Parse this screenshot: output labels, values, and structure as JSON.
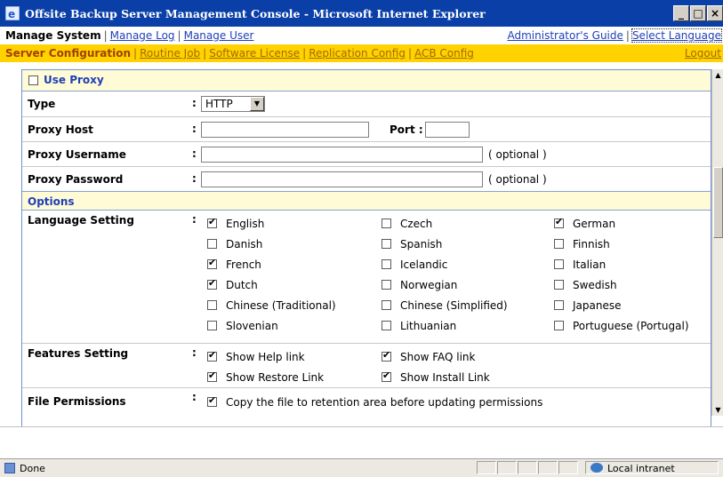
{
  "window": {
    "title": "Offsite Backup Server Management Console - Microsoft Internet Explorer",
    "icon": "ie-icon",
    "buttons": [
      "_",
      "□",
      "×"
    ]
  },
  "nav1": {
    "current": "Manage System",
    "links": [
      "Manage Log",
      "Manage User"
    ],
    "right_links": [
      "Administrator's Guide",
      "Select Language"
    ]
  },
  "nav2": {
    "current": "Server Configuration",
    "links": [
      "Routine Job",
      "Software License",
      "Replication Config",
      "ACB Config"
    ],
    "right_link": "Logout"
  },
  "proxy": {
    "use_proxy_label": "Use Proxy",
    "use_proxy_checked": false,
    "type_label": "Type",
    "type_value": "HTTP",
    "host_label": "Proxy Host",
    "host_value": "",
    "port_label": "Port :",
    "port_value": "",
    "username_label": "Proxy Username",
    "username_value": "",
    "password_label": "Proxy Password",
    "password_value": "",
    "optional_note": "( optional )"
  },
  "options": {
    "header": "Options",
    "language_label": "Language Setting",
    "languages": [
      {
        "label": "English",
        "checked": true
      },
      {
        "label": "Czech",
        "checked": false
      },
      {
        "label": "German",
        "checked": true
      },
      {
        "label": "Danish",
        "checked": false
      },
      {
        "label": "Spanish",
        "checked": false
      },
      {
        "label": "Finnish",
        "checked": false
      },
      {
        "label": "French",
        "checked": true
      },
      {
        "label": "Icelandic",
        "checked": false
      },
      {
        "label": "Italian",
        "checked": false
      },
      {
        "label": "Dutch",
        "checked": true
      },
      {
        "label": "Norwegian",
        "checked": false
      },
      {
        "label": "Swedish",
        "checked": false
      },
      {
        "label": "Chinese (Traditional)",
        "checked": false
      },
      {
        "label": "Chinese (Simplified)",
        "checked": false
      },
      {
        "label": "Japanese",
        "checked": false
      },
      {
        "label": "Slovenian",
        "checked": false
      },
      {
        "label": "Lithuanian",
        "checked": false
      },
      {
        "label": "Portuguese (Portugal)",
        "checked": false
      }
    ],
    "features_label": "Features Setting",
    "features": [
      {
        "label": "Show Help link",
        "checked": true
      },
      {
        "label": "Show FAQ link",
        "checked": true
      },
      {
        "label": "Show Restore Link",
        "checked": true
      },
      {
        "label": "Show Install Link",
        "checked": true
      }
    ],
    "permissions_label": "File Permissions",
    "permissions": {
      "label": "Copy the file to retention area before updating permissions",
      "checked": true
    }
  },
  "status": {
    "text": "Done",
    "zone": "Local intranet"
  },
  "colors": {
    "titlebar": "#0a3fa8",
    "nav2_bg": "#ffd200",
    "section_header_bg": "#fffbd6",
    "link": "#1f3fb8"
  }
}
